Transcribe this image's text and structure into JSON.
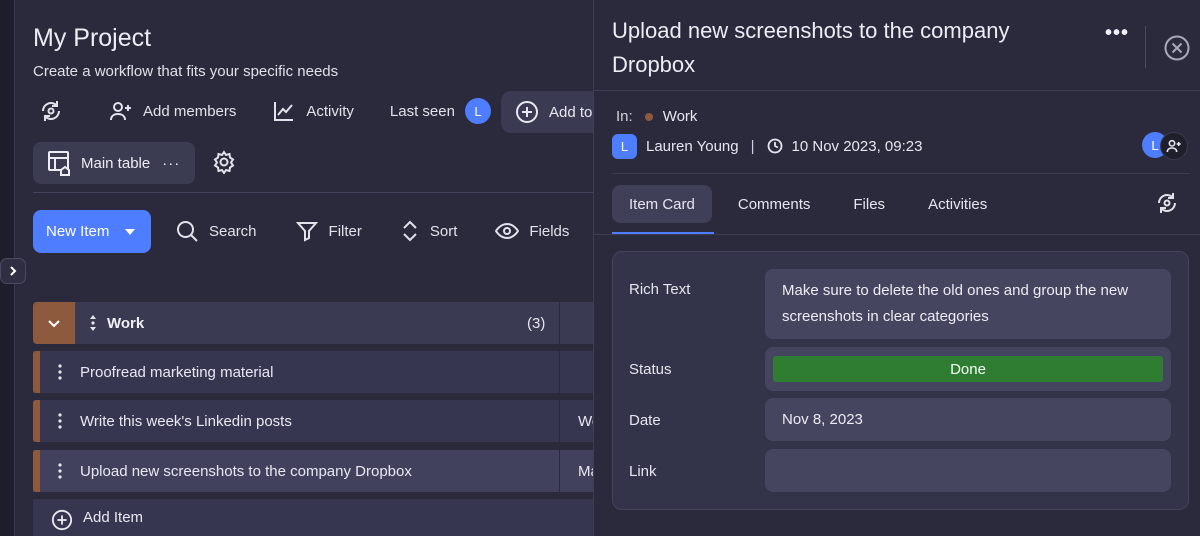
{
  "project": {
    "title": "My Project",
    "subtitle": "Create a workflow that fits your specific needs"
  },
  "toolbar": {
    "add_members": "Add members",
    "activity": "Activity",
    "last_seen": "Last seen",
    "last_seen_avatar": "L",
    "add_to": "Add to"
  },
  "view": {
    "main_table": "Main table",
    "more": "···"
  },
  "actions": {
    "new_item": "New Item",
    "search": "Search",
    "filter": "Filter",
    "sort": "Sort",
    "fields": "Fields"
  },
  "group": {
    "name": "Work",
    "count": "(3)",
    "color": "#8e5a3e"
  },
  "rows": [
    {
      "name": "Proofread marketing material",
      "col2": ""
    },
    {
      "name": "Write this week's Linkedin posts",
      "col2": "We"
    },
    {
      "name": "Upload new screenshots to the company Dropbox",
      "col2": "Ma"
    }
  ],
  "add_item": "Add Item",
  "detail": {
    "title": "Upload new screenshots to the company Dropbox",
    "more": "•••",
    "in_label": "In:",
    "group": "Work",
    "owner_avatar": "L",
    "owner": "Lauren Young",
    "separator": "|",
    "timestamp": "10 Nov 2023, 09:23",
    "assignee_avatar": "L",
    "tabs": [
      {
        "label": "Item Card",
        "active": true
      },
      {
        "label": "Comments",
        "active": false
      },
      {
        "label": "Files",
        "active": false
      },
      {
        "label": "Activities",
        "active": false
      }
    ],
    "fields": {
      "rich_text_label": "Rich Text",
      "rich_text_value": "Make sure to delete the old ones and group the new screenshots in clear categories",
      "status_label": "Status",
      "status_value": "Done",
      "status_color": "#2e7d32",
      "date_label": "Date",
      "date_value": "Nov 8, 2023",
      "link_label": "Link",
      "link_value": ""
    }
  },
  "colors": {
    "accent": "#4f7dff",
    "panel": "#2b2a3d"
  }
}
